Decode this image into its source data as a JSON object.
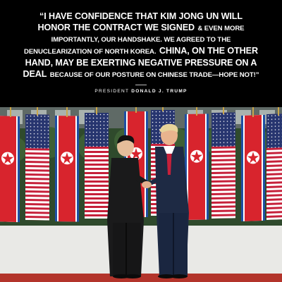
{
  "quote": {
    "line1": "“I HAVE CONFIDENCE THAT KIM JONG UN WILL",
    "line2a": "HONOR THE CONTRACT WE SIGNED",
    "line2b": "& EVEN MORE",
    "line3": "IMPORTANTLY, OUR HANDSHAKE. WE AGREED TO THE",
    "line4a": "DENUCLEARIZATION OF NORTH KOREA.",
    "line4b": "CHINA, ON THE OTHER",
    "line5": "HAND, MAY BE EXERTING NEGATIVE PRESSURE ON A",
    "line6a": "DEAL",
    "line6b": "BECAUSE OF OUR POSTURE ON CHINESE TRADE—HOPE NOT!”"
  },
  "attribution": {
    "role": "PRESIDENT",
    "name": "DONALD J. TRUMP"
  },
  "photo": {
    "subject": "handshake-in-front-of-flags",
    "colors": {
      "nk_red": "#d8242d",
      "nk_blue": "#1f4fa3",
      "us_red": "#c6203a",
      "us_blue": "#27356f",
      "carpet": "#b3342b"
    }
  }
}
